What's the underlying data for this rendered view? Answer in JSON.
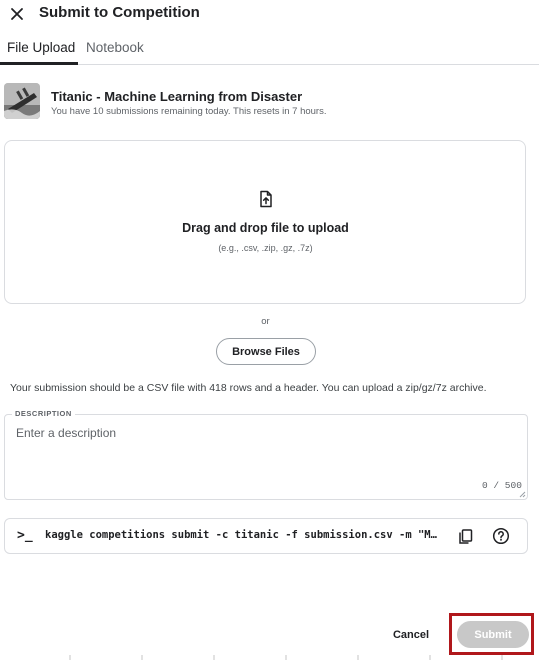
{
  "dialog": {
    "title": "Submit to Competition",
    "close_icon": "close-icon"
  },
  "tabs": [
    {
      "label": "File Upload",
      "active": true
    },
    {
      "label": "Notebook",
      "active": false
    }
  ],
  "competition": {
    "name": "Titanic - Machine Learning from Disaster",
    "subtitle": "You have 10 submissions remaining today. This resets in 7 hours."
  },
  "dropzone": {
    "icon": "file-upload-icon",
    "title": "Drag and drop file to upload",
    "hint": "(e.g., .csv, .zip, .gz, .7z)"
  },
  "or_text": "or",
  "browse_label": "Browse Files",
  "info_text": "Your submission should be a CSV file with 418 rows and a header. You can upload a zip/gz/7z archive.",
  "description": {
    "label": "DESCRIPTION",
    "placeholder": "Enter a description",
    "value": "",
    "counter": "0 / 500"
  },
  "command": {
    "prompt": ">_",
    "text": "kaggle competitions submit -c titanic -f submission.csv -m \"Message\"",
    "copy_icon": "copy-icon",
    "help_icon": "help-icon"
  },
  "footer": {
    "cancel_label": "Cancel",
    "submit_label": "Submit",
    "submit_enabled": false,
    "highlight_color": "#b0171b"
  }
}
